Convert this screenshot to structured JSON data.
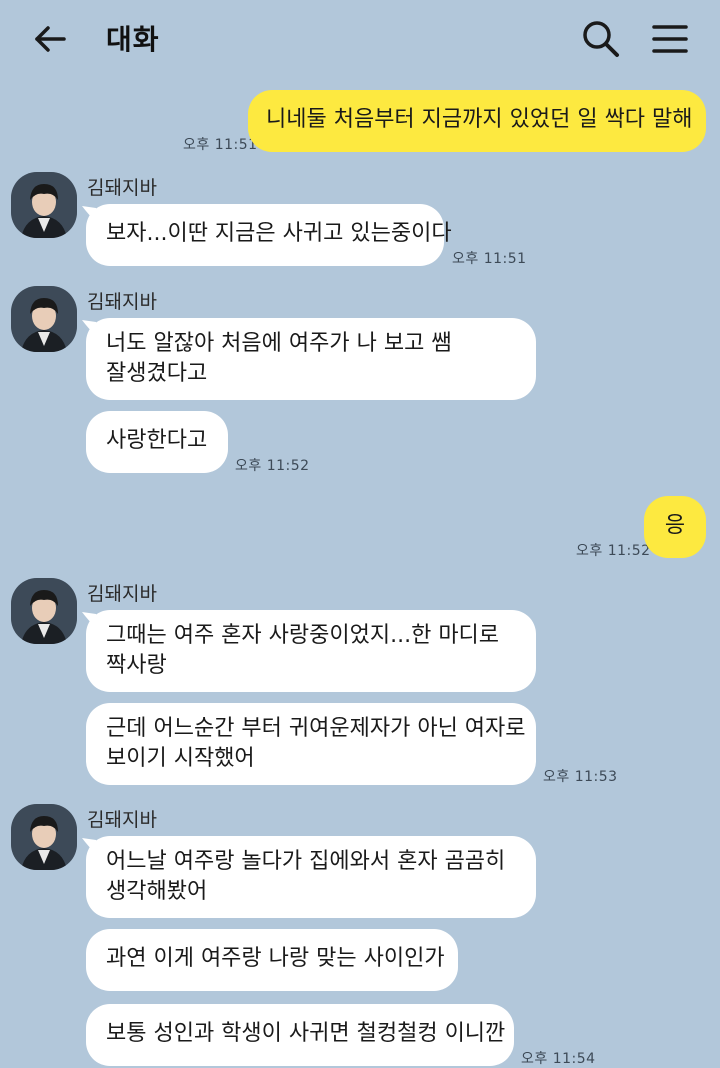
{
  "header": {
    "title": "대화"
  },
  "icons": {
    "back": "back-arrow-icon",
    "search": "search-icon",
    "menu": "hamburger-menu-icon"
  },
  "colors": {
    "background": "#b2c7da",
    "my_bubble": "#fde940",
    "other_bubble": "#ffffff"
  },
  "messages": {
    "m1": {
      "text": "니네둘 처음부터 지금까지 있었던 일 싹다 말해",
      "time": "오후 11:51"
    },
    "g1": {
      "sender": "김돼지바",
      "text": "보자...이딴 지금은 사귀고 있는중이다",
      "time": "오후 11:51"
    },
    "g2": {
      "sender": "김돼지바",
      "b1_line1": "너도 알잖아 처음에 여주가 나 보고 쌤",
      "b1_line2": "잘생겼다고",
      "b2": "사랑한다고",
      "time": "오후 11:52"
    },
    "m2": {
      "text": "응",
      "time": "오후 11:52"
    },
    "g3": {
      "sender": "김돼지바",
      "b1_line1": "그때는 여주 혼자 사랑중이었지...한 마디로",
      "b1_line2": "짝사랑",
      "b2_line1": "근데 어느순간 부터 귀여운제자가 아닌 여자로",
      "b2_line2": "보이기 시작했어",
      "time": "오후 11:53"
    },
    "g4": {
      "sender": "김돼지바",
      "b1_line1": "어느날 여주랑 놀다가 집에와서 혼자 곰곰히",
      "b1_line2": "생각해봤어",
      "b2": "과연 이게 여주랑 나랑 맞는 사이인가",
      "b3": "보통 성인과 학생이 사귀면 철컹철컹 이니깐",
      "time": "오후 11:54"
    }
  }
}
